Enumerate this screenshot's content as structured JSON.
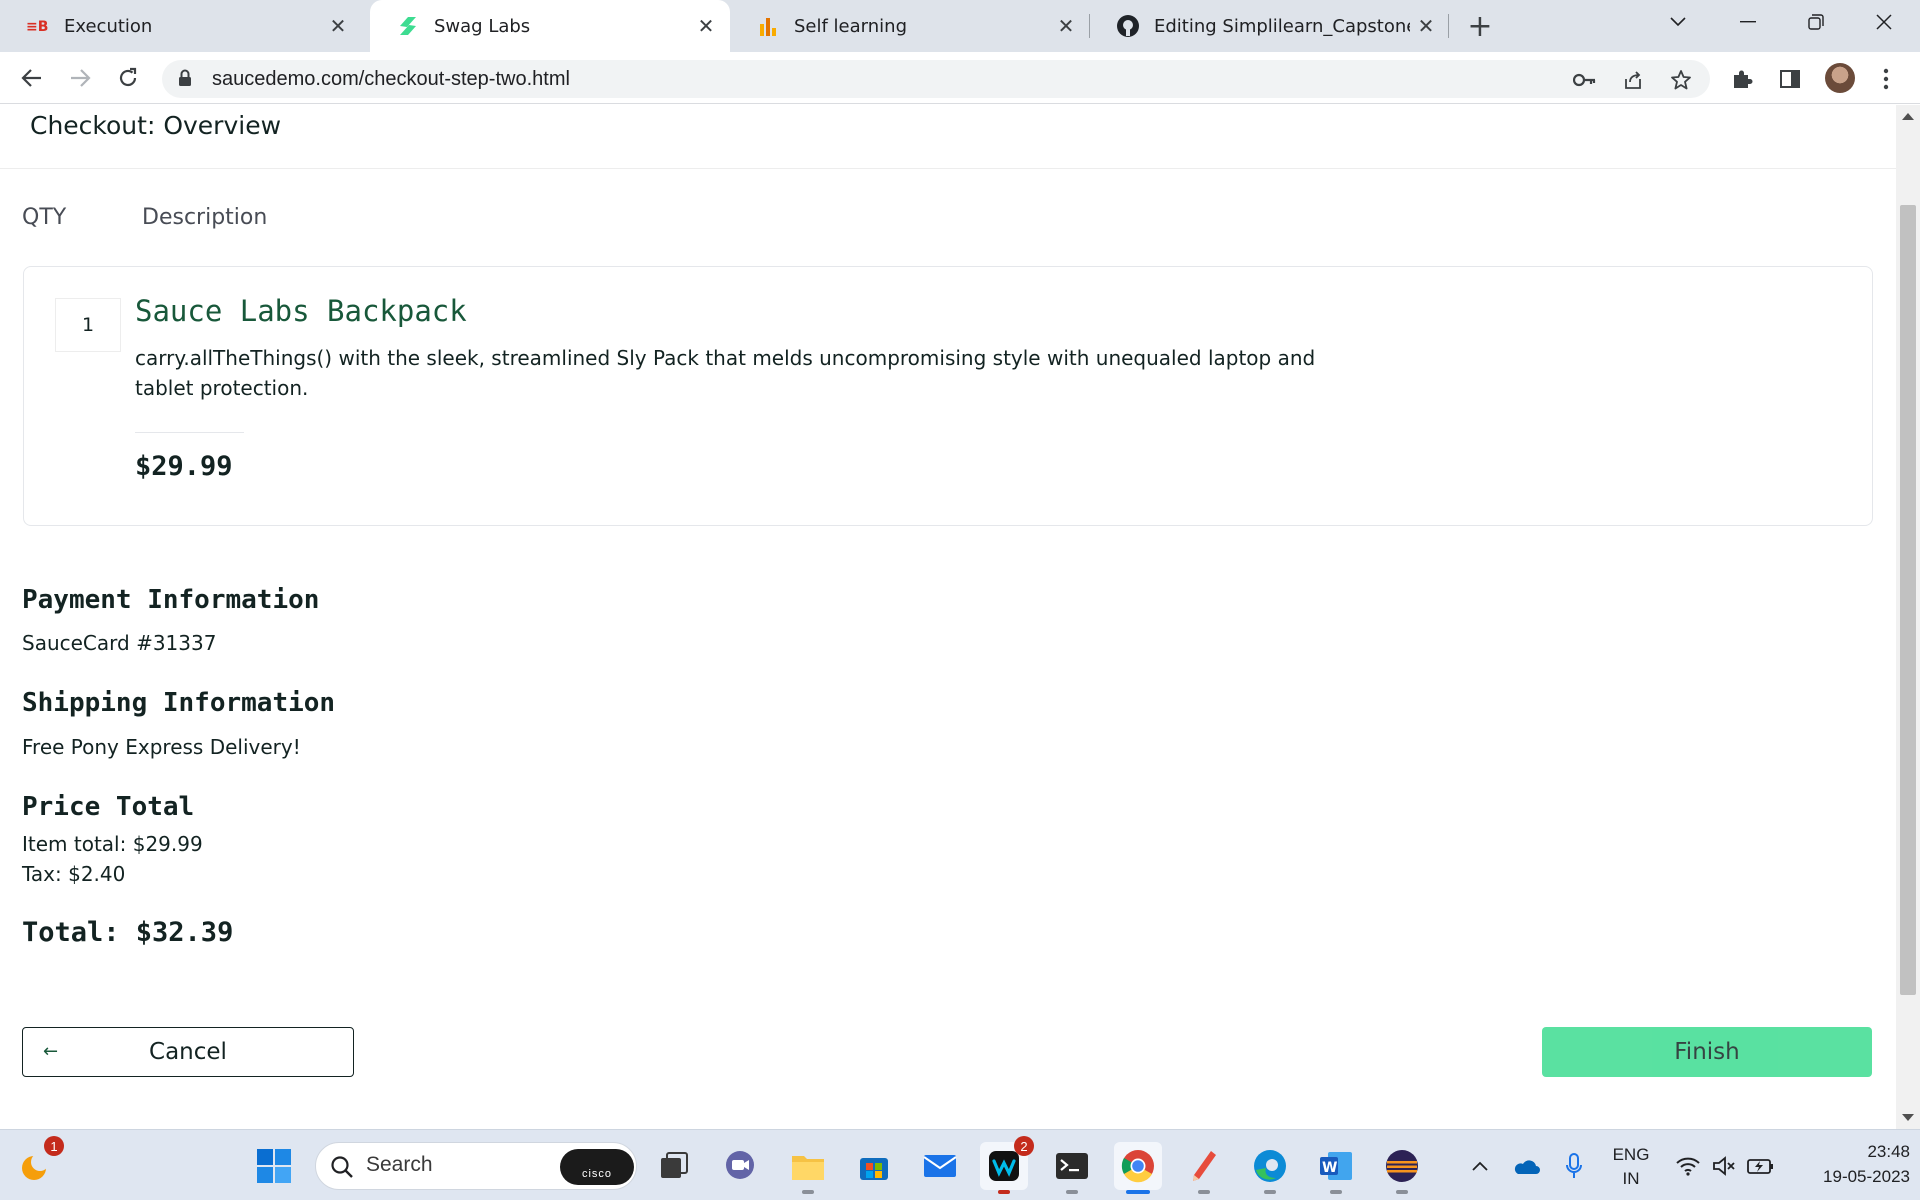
{
  "browser": {
    "tabs": [
      {
        "title": "Execution",
        "active": false
      },
      {
        "title": "Swag Labs",
        "active": true
      },
      {
        "title": "Self learning",
        "active": false
      },
      {
        "title": "Editing Simplilearn_CapstoneProj",
        "active": false
      }
    ],
    "url": "saucedemo.com/checkout-step-two.html"
  },
  "page": {
    "title": "Checkout: Overview",
    "columns": {
      "qty": "QTY",
      "description": "Description"
    },
    "item": {
      "qty": "1",
      "name": "Sauce Labs Backpack",
      "description": "carry.allTheThings() with the sleek, streamlined Sly Pack that melds uncompromising style with unequaled laptop and tablet protection.",
      "price": "$29.99"
    },
    "payment": {
      "label": "Payment Information",
      "value": "SauceCard #31337"
    },
    "shipping": {
      "label": "Shipping Information",
      "value": "Free Pony Express Delivery!"
    },
    "price": {
      "label": "Price Total",
      "item_total": "Item total: $29.99",
      "tax": "Tax: $2.40",
      "total": "Total: $32.39"
    },
    "buttons": {
      "cancel": "Cancel",
      "finish": "Finish"
    }
  },
  "taskbar": {
    "search_placeholder": "Search",
    "cisco_label": "cisco",
    "lang_top": "ENG",
    "lang_bottom": "IN",
    "time": "23:48",
    "date": "19-05-2023",
    "notification_badge": "1",
    "teams_badge": "2"
  },
  "colors": {
    "accent_green": "#3ddc91",
    "product_title": "#18583a",
    "text": "#132322"
  }
}
